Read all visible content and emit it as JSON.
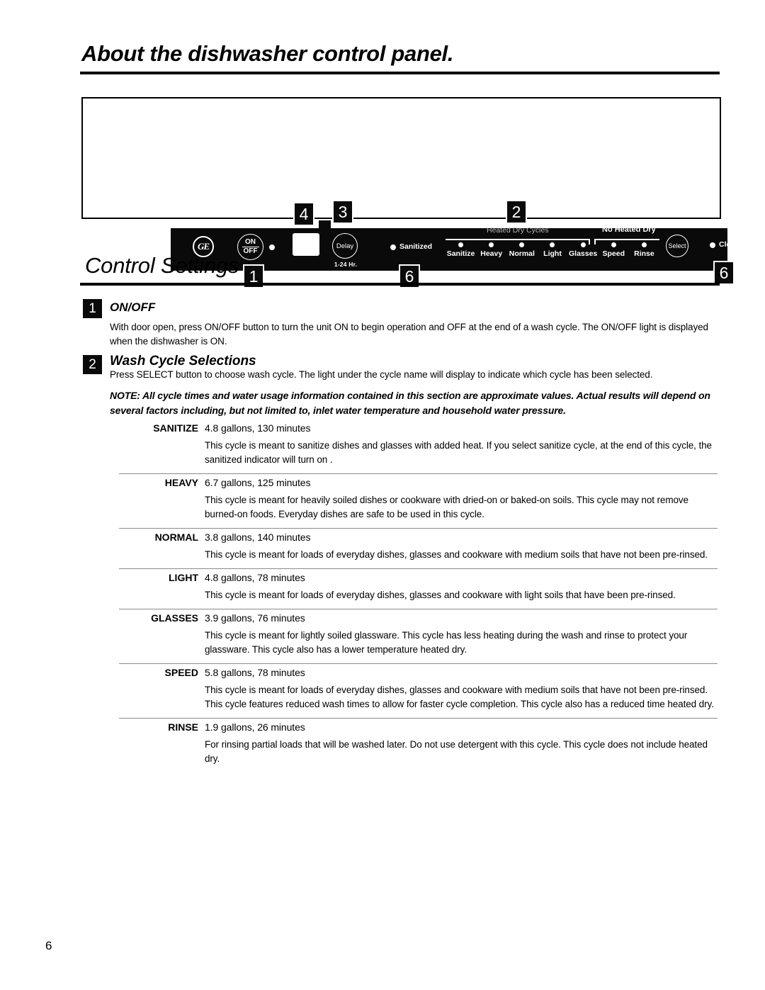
{
  "page": {
    "title": "About the dishwasher control panel.",
    "section_title": "Control Settings",
    "page_number": "6"
  },
  "control_panel": {
    "brand_logo": "GE",
    "onoff_button": {
      "line1": "ON",
      "line2": "OFF"
    },
    "delay_button": {
      "label": "Delay",
      "sublabel": "1-24 Hr."
    },
    "sanitized_indicator": "Sanitized",
    "group_heated_dry": "Heated Dry Cycles",
    "group_no_heated_dry": "No Heated Dry",
    "cycle_marks": [
      {
        "name": "Sanitize"
      },
      {
        "name": "Heavy"
      },
      {
        "name": "Normal"
      },
      {
        "name": "Light"
      },
      {
        "name": "Glasses"
      },
      {
        "name": "Speed"
      },
      {
        "name": "Rinse"
      }
    ],
    "select_button": "Select",
    "clean_indicator": "Clean",
    "callouts": {
      "one": "1",
      "two": "2",
      "three": "3",
      "four": "4",
      "six_a": "6",
      "six_b": "6"
    }
  },
  "settings": {
    "item1": {
      "badge": "1",
      "heading": "ON/OFF",
      "body": "With door open, press ON/OFF button to turn the unit ON to begin operation and OFF at the end of a wash cycle. The ON/OFF light is displayed when the dishwasher is ON."
    },
    "item2": {
      "badge": "2",
      "heading": "Wash Cycle Selections",
      "body": "Press SELECT button to choose wash cycle. The light under the cycle name will display to indicate which cycle has been selected.",
      "note": "NOTE: All cycle times and water usage information contained in this section are approximate values. Actual results will depend on several factors including, but not limited to, inlet water temperature and household water pressure."
    }
  },
  "cycles": [
    {
      "name": "SANITIZE",
      "spec": "4.8 gallons, 130 minutes",
      "description": "This cycle is meant to sanitize dishes and glasses with added heat. If you select sanitize cycle, at the end of this cycle, the sanitized indicator will turn on ."
    },
    {
      "name": "HEAVY",
      "spec": "6.7 gallons, 125 minutes",
      "description": "This cycle is meant for heavily soiled dishes or cookware with dried-on or baked-on soils. This cycle may not remove burned-on foods. Everyday dishes are safe to be used in this cycle."
    },
    {
      "name": "NORMAL",
      "spec": "3.8 gallons, 140 minutes",
      "description": "This cycle is meant for loads of everyday dishes, glasses and cookware with medium soils that have not been pre-rinsed."
    },
    {
      "name": "LIGHT",
      "spec": "4.8 gallons, 78 minutes",
      "description": "This cycle is meant for loads of everyday dishes, glasses and cookware with light soils that have been pre-rinsed."
    },
    {
      "name": "GLASSES",
      "spec": "3.9 gallons, 76 minutes",
      "description": "This cycle is meant for lightly soiled glassware. This cycle has less heating during the wash and rinse to protect your glassware. This cycle also has a lower temperature heated dry."
    },
    {
      "name": "SPEED",
      "spec": "5.8 gallons, 78 minutes",
      "description": "This cycle is meant for loads of everyday dishes, glasses and cookware with medium soils that have not been pre-rinsed. This cycle features reduced wash times to allow for faster cycle completion. This cycle also has a reduced time heated dry."
    },
    {
      "name": "RINSE",
      "spec": "1.9 gallons, 26 minutes",
      "description": "For rinsing partial loads that will be washed later. Do not use detergent with this cycle. This cycle does not include heated dry."
    }
  ]
}
